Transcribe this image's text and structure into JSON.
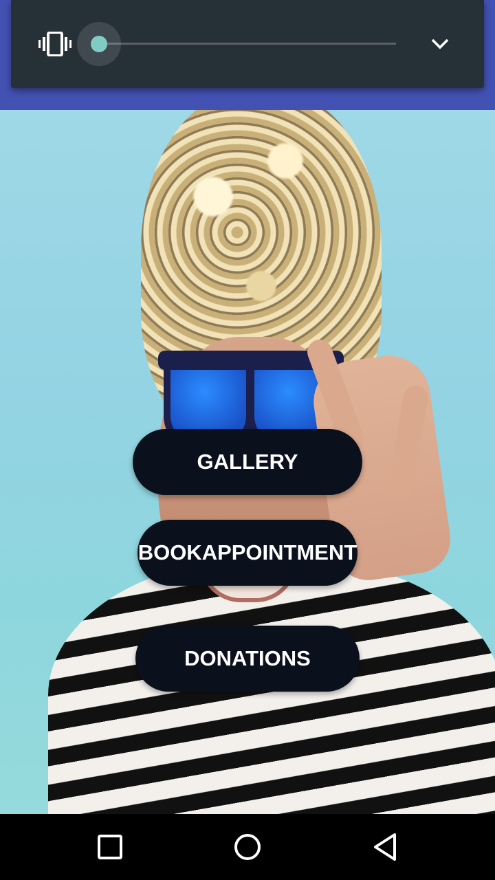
{
  "app_bar": {
    "title": "",
    "color": "#4351b3"
  },
  "volume_panel": {
    "mode_icon": "vibrate-icon",
    "level": 0,
    "expand_icon": "chevron-down-icon"
  },
  "main": {
    "buttons": [
      {
        "label": "GALLERY"
      },
      {
        "label": "BOOKAPPOINTMENT"
      },
      {
        "label": "DONATIONS"
      }
    ],
    "button_color": "#0a111d"
  },
  "nav_bar": {
    "icons": [
      "recents-icon",
      "home-icon",
      "back-icon"
    ]
  }
}
